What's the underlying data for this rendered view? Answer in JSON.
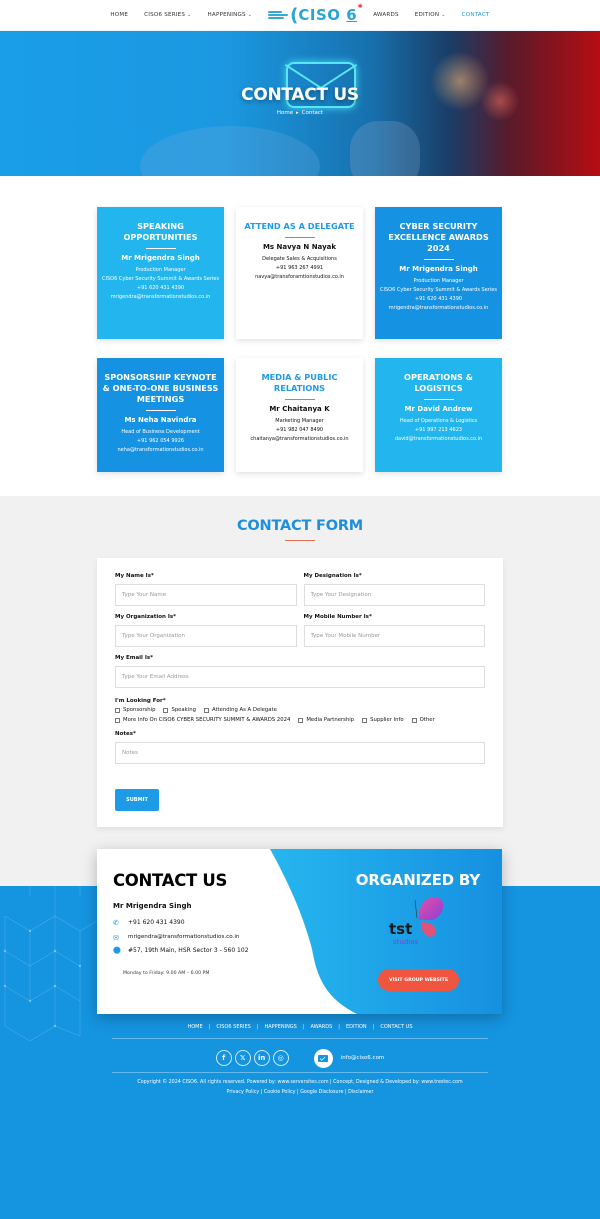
{
  "nav": {
    "items_left": [
      {
        "label": "HOME",
        "dropdown": false
      },
      {
        "label": "CISO6 SERIES",
        "dropdown": true
      },
      {
        "label": "HAPPENINGS",
        "dropdown": true
      }
    ],
    "logo_text": "CISO",
    "logo_number": "6",
    "items_right": [
      {
        "label": "AWARDS",
        "dropdown": false
      },
      {
        "label": "EDITION",
        "dropdown": true
      },
      {
        "label": "CONTACT",
        "dropdown": false,
        "active": true
      }
    ]
  },
  "hero": {
    "title": "CONTACT US",
    "breadcrumb": [
      "Home",
      "Contact"
    ],
    "breadcrumb_separator": "▸"
  },
  "cards": [
    {
      "title": "SPEAKING OPPORTUNITIES",
      "name": "Mr Mrigendra Singh",
      "lines": [
        "Production Manager",
        "CISO6 Cyber Security Summit & Awards Series",
        "+91 620 431 4390",
        "mrigendra@transformationstudios.co.in"
      ],
      "style": "light"
    },
    {
      "title": "ATTEND AS A DELEGATE",
      "name": "Ms Navya N Nayak",
      "lines": [
        "Delegate Sales & Acquisitions",
        "+91 963 267 4991",
        "navya@transforamtionstudios.co.in"
      ],
      "style": "white"
    },
    {
      "title": "CYBER SECURITY EXCELLENCE AWARDS 2024",
      "name": "Mr Mrigendra Singh",
      "lines": [
        "Production Manager",
        "CISO6 Cyber Security Summit & Awards Series",
        "+91 620 431 4390",
        "mrigendra@transformationstudios.co.in"
      ],
      "style": "dark"
    },
    {
      "title": "SPONSORSHIP KEYNOTE & ONE-TO-ONE BUSINESS MEETINGS",
      "name": "Ms Neha Navindra",
      "lines": [
        "Head of Business Development",
        "+91 962 054 9926",
        "neha@transformationstudios.co.in"
      ],
      "style": "dark"
    },
    {
      "title": "MEDIA & PUBLIC RELATIONS",
      "name": "Mr Chaitanya K",
      "lines": [
        "Marketing Manager",
        "+91 982 047 8490",
        "chaitanya@transformationstudios.co.in"
      ],
      "style": "white"
    },
    {
      "title": "OPERATIONS & LOGISTICS",
      "name": "Mr David Andrew",
      "lines": [
        "Head of Operations & Logistics",
        "+91 997 213 4623",
        "david@transformationstudios.co.in"
      ],
      "style": "light"
    }
  ],
  "form": {
    "heading": "CONTACT FORM",
    "name": {
      "label": "My Name Is*",
      "placeholder": "Type Your Name",
      "value": ""
    },
    "designation": {
      "label": "My Designation Is*",
      "placeholder": "Type Your Designation",
      "value": ""
    },
    "organization": {
      "label": "My Organization Is*",
      "placeholder": "Type Your Organization",
      "value": ""
    },
    "mobile": {
      "label": "My Mobile Number Is*",
      "placeholder": "Type Your Mobile Number",
      "value": ""
    },
    "email": {
      "label": "My Email Is*",
      "placeholder": "Type Your Email Address",
      "value": ""
    },
    "looking_for": {
      "label": "I'm Looking For*",
      "options_row1": [
        "Sponsorship",
        "Speaking",
        "Attending As A Delegate"
      ],
      "options_row2": [
        "More Info On CISO6 CYBER SECURITY SUMMIT & AWARDS 2024",
        "Media Partnership",
        "Supplier Info",
        "Other"
      ]
    },
    "notes": {
      "label": "Notes*",
      "placeholder": "Notes",
      "value": ""
    },
    "submit_label": "SUBMIT"
  },
  "contact_box": {
    "title": "CONTACT US",
    "name": "Mr Mrigendra Singh",
    "phone": "+91 620 431 4390",
    "email": "mrigendra@transformationstudios.co.in",
    "address": "#57, 19th Main, HSR Sector 3 - 560 102",
    "hours": "Monday to Friday: 9.00 AM – 6.00 PM",
    "organized_by": "ORGANIZED BY",
    "org_logo_text": "tst",
    "org_logo_sub": "studios",
    "visit_button": "VISIT GROUP WEBSITE"
  },
  "footer": {
    "nav": [
      "HOME",
      "CISO6 SERIES",
      "HAPPENINGS",
      "AWARDS",
      "EDITION",
      "CONTACT US"
    ],
    "social": [
      {
        "icon": "facebook-icon",
        "glyph": "f"
      },
      {
        "icon": "x-twitter-icon",
        "glyph": "𝕏"
      },
      {
        "icon": "linkedin-icon",
        "glyph": "in"
      },
      {
        "icon": "instagram-icon",
        "glyph": "◎"
      }
    ],
    "email": "info@ciso6.com",
    "copyright": "Copyright © 2024 CISO6. All rights reserved. Powered by: www.serversites.com | Concept, Designed & Developed by: www.trestec.com",
    "links": [
      "Privacy Policy",
      "Cookie Policy",
      "Google Disclosure",
      "Disclaimer"
    ]
  },
  "colors": {
    "brand_blue": "#1e9be6",
    "card_light": "#23b5ee",
    "card_dark": "#1592e2",
    "accent_red": "#e07050",
    "button_orange": "#f0553f",
    "footer_blue": "#1594e0"
  }
}
